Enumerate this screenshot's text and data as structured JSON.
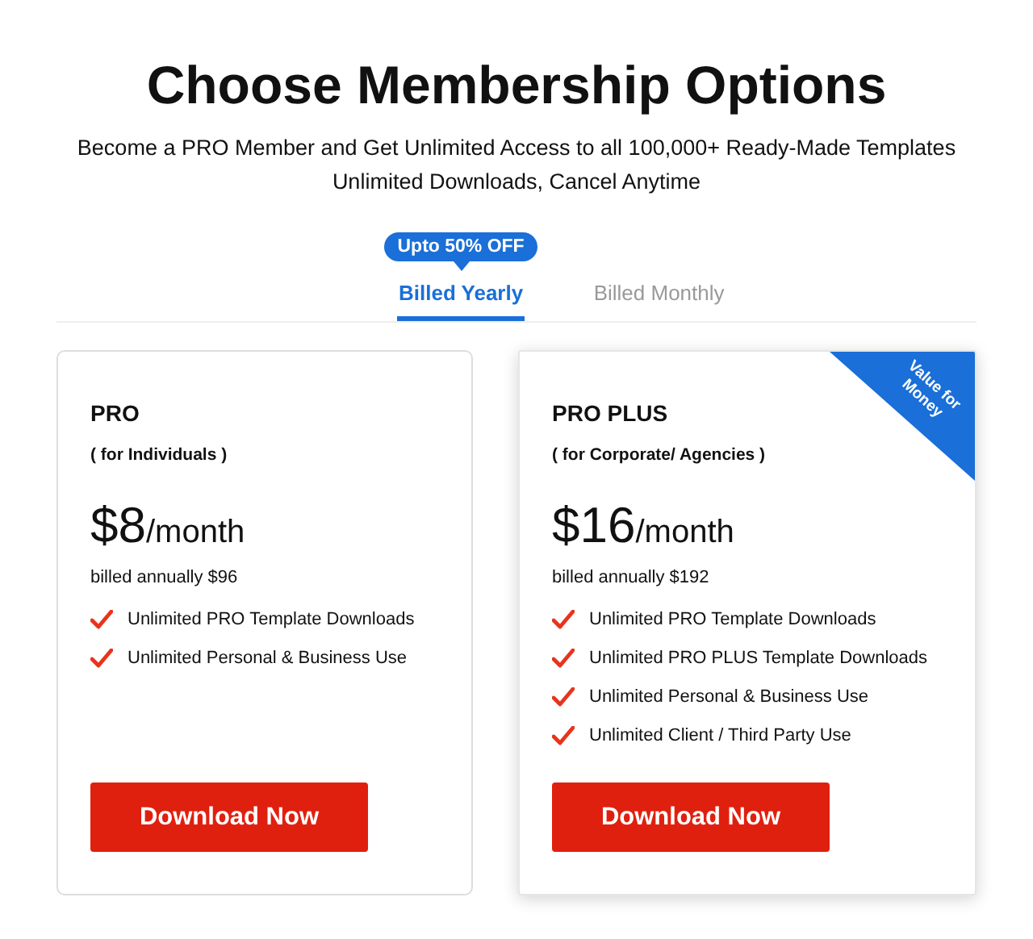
{
  "title": "Choose Membership Options",
  "subtitle_lines": [
    "Become a PRO Member and Get Unlimited Access to all 100,000+ Ready-Made Templates",
    "Unlimited Downloads, Cancel Anytime"
  ],
  "billing_tabs": [
    {
      "label": "Billed Yearly",
      "selected": true,
      "badge": "Upto 50% OFF"
    },
    {
      "label": "Billed Monthly",
      "selected": false
    }
  ],
  "plans": [
    {
      "name": "PRO",
      "audience": "( for Individuals )",
      "amount": "$8",
      "period": "/month",
      "billed": "billed annually $96",
      "features": [
        "Unlimited PRO Template Downloads",
        "Unlimited Personal & Business Use"
      ],
      "button": "Download Now",
      "highlighted": false
    },
    {
      "name": "PRO PLUS",
      "audience": "( for Corporate/ Agencies )",
      "amount": "$16",
      "period": "/month",
      "billed": "billed annually $192",
      "ribbon": "Value for Money",
      "features": [
        "Unlimited PRO Template Downloads",
        "Unlimited PRO PLUS Template Downloads",
        "Unlimited Personal & Business Use",
        "Unlimited Client / Third Party Use"
      ],
      "button": "Download Now",
      "highlighted": true
    }
  ]
}
